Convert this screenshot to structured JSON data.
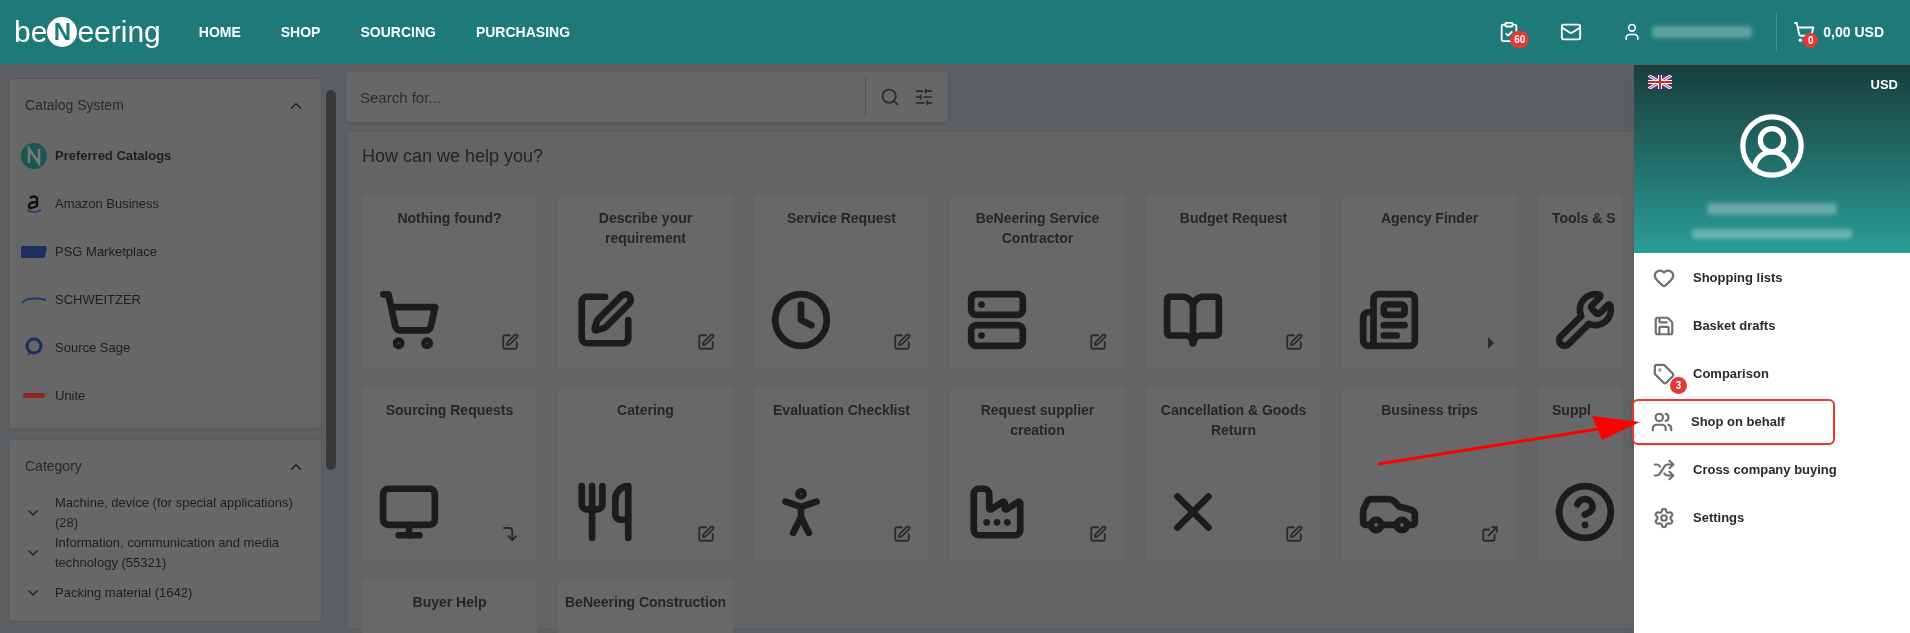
{
  "header": {
    "logo": {
      "prefix": "be",
      "mark": "N",
      "suffix": "eering"
    },
    "nav": [
      {
        "label": "HOME"
      },
      {
        "label": "SHOP"
      },
      {
        "label": "SOURCING"
      },
      {
        "label": "PURCHASING"
      }
    ],
    "tasks_badge": "60",
    "cart_badge": "0",
    "cart_total": "0,00 USD"
  },
  "sidebar": {
    "sections": [
      {
        "title": "Catalog System",
        "expanded": true,
        "items": [
          {
            "label": "Preferred Catalogs",
            "selected": true
          },
          {
            "label": "Amazon Business",
            "selected": false
          },
          {
            "label": "PSG Marketplace",
            "selected": false
          },
          {
            "label": "SCHWEITZER",
            "selected": false
          },
          {
            "label": "Source Sage",
            "selected": false
          },
          {
            "label": "Unite",
            "selected": false
          }
        ]
      },
      {
        "title": "Category",
        "expanded": true,
        "items": [
          {
            "label": "Machine, device (for special applications) (28)",
            "expanded": false
          },
          {
            "label": "Information, communication and media technology (55321)",
            "expanded": false
          },
          {
            "label": "Packing material (1642)",
            "expanded": false
          }
        ]
      }
    ]
  },
  "search": {
    "placeholder": "Search for..."
  },
  "help": {
    "title": "How can we help you?",
    "tiles": [
      {
        "title": "Nothing found?"
      },
      {
        "title": "Describe your requirement"
      },
      {
        "title": "Service Request"
      },
      {
        "title": "BeNeering Service Contractor"
      },
      {
        "title": "Budget Request"
      },
      {
        "title": "Agency Finder"
      },
      {
        "title": "Tools & S"
      },
      {
        "title": "Sourcing Requests"
      },
      {
        "title": "Catering"
      },
      {
        "title": "Evaluation Checklist"
      },
      {
        "title": "Request supplier creation"
      },
      {
        "title": "Cancellation & Goods Return"
      },
      {
        "title": "Business trips"
      },
      {
        "title": "Suppl"
      },
      {
        "title": "Buyer Help"
      },
      {
        "title": "BeNeering Construction"
      }
    ]
  },
  "user_menu": {
    "currency": "USD",
    "items": [
      {
        "label": "Shopping lists",
        "highlighted": false
      },
      {
        "label": "Basket drafts",
        "highlighted": false
      },
      {
        "label": "Comparison",
        "badge": "3",
        "highlighted": false
      },
      {
        "label": "Shop on behalf",
        "highlighted": true
      },
      {
        "label": "Cross company buying",
        "highlighted": false
      },
      {
        "label": "Settings",
        "highlighted": false
      }
    ]
  }
}
